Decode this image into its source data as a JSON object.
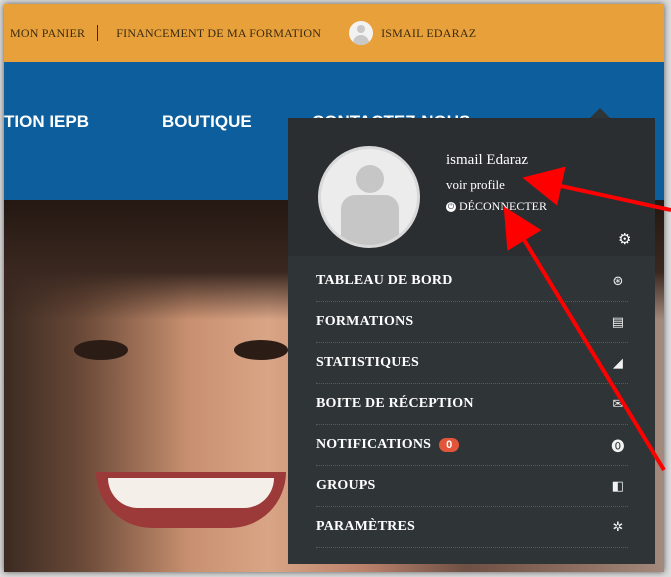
{
  "topbar": {
    "cart": "MON PANIER",
    "financing": "FINANCEMENT DE MA FORMATION",
    "user": "ISMAIL EDARAZ"
  },
  "nav": {
    "item1": "TION IEPB",
    "item2": "BOUTIQUE",
    "item3": "CONTACTEZ-NOUS"
  },
  "dropdown": {
    "name": "ismail Edaraz",
    "profile_link": "voir profile",
    "logout": "DÉCONNECTER",
    "menu": [
      {
        "label": "TABLEAU DE BORD",
        "icon": "dashboard-icon",
        "glyph": "⊛"
      },
      {
        "label": "FORMATIONS",
        "icon": "book-icon",
        "glyph": "▤"
      },
      {
        "label": "STATISTIQUES",
        "icon": "area-chart-icon",
        "glyph": "◢"
      },
      {
        "label": "BOITE DE RÉCEPTION",
        "icon": "envelope-icon",
        "glyph": "✉"
      },
      {
        "label": "NOTIFICATIONS",
        "icon": "alert-icon",
        "glyph": "⓿",
        "badge": "0"
      },
      {
        "label": "GROUPS",
        "icon": "groups-icon",
        "glyph": "◧"
      },
      {
        "label": "PARAMÈTRES",
        "icon": "gear-icon",
        "glyph": "✲"
      }
    ]
  },
  "colors": {
    "topbar": "#e8a13a",
    "nav": "#0c5f9c",
    "dropdown": "#2f3437",
    "badge": "#e3553a",
    "arrow": "#ff0000"
  }
}
